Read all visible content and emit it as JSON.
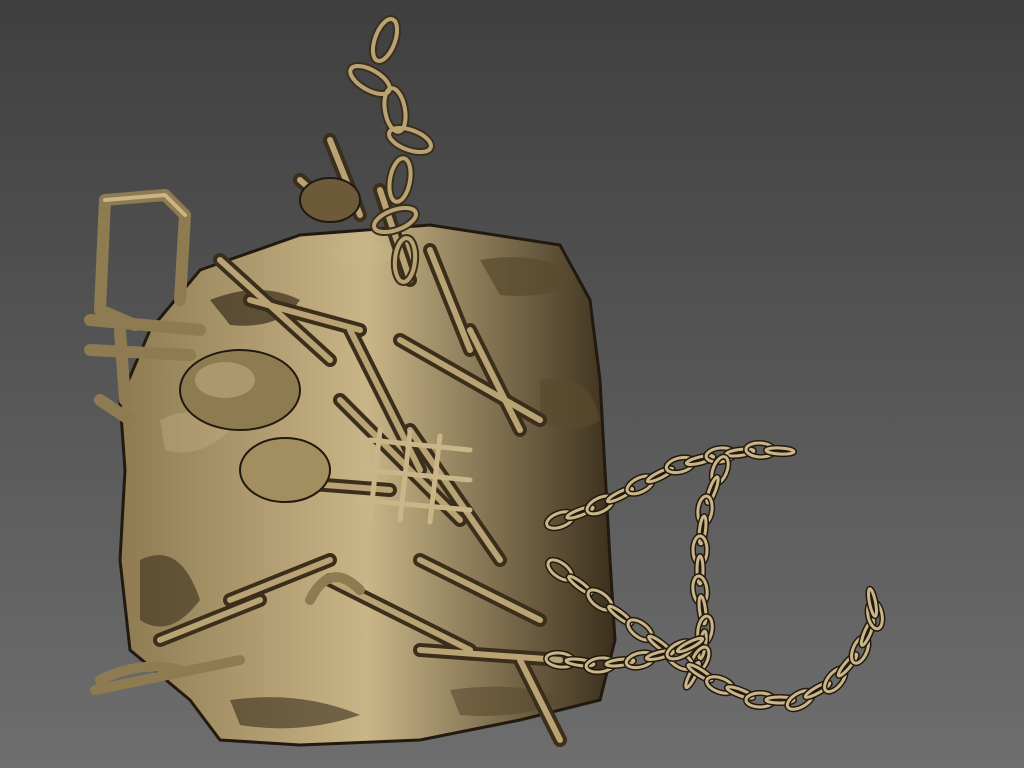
{
  "viewport": {
    "background_top": "#3f3f3f",
    "background_bottom": "#6e6e6e"
  },
  "model": {
    "subject": "sculpted-block-of-debris-with-chains",
    "material_colors": {
      "highlight": "#c9b587",
      "mid": "#8f7b52",
      "dark": "#3b2f1c",
      "shadow": "#221a10"
    }
  }
}
